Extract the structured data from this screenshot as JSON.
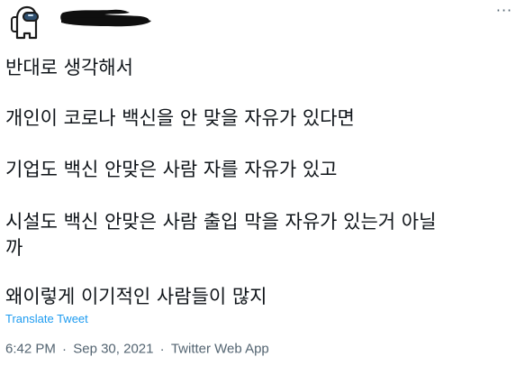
{
  "tweet": {
    "lines": [
      "반대로 생각해서",
      "개인이 코로나 백신을 안 맞을 자유가 있다면",
      "기업도 백신 안맞은 사람 자를 자유가 있고",
      "시설도 백신 안맞은 사람 출입 막을 자유가 있는거 아닐",
      "까",
      "왜이렇게 이기적인 사람들이 많지"
    ],
    "translate_label": "Translate Tweet",
    "more_label": "···",
    "timestamp_time": "6:42 PM",
    "timestamp_date": "Sep 30, 2021",
    "separator": "·",
    "source": "Twitter Web App"
  },
  "colors": {
    "text": "#0f1419",
    "muted": "#536471",
    "link": "#1d9bf0",
    "avatar_body": "#ffffff",
    "avatar_outline": "#1b1b1b",
    "avatar_visor": "#2f4f6f"
  },
  "icons": {
    "avatar": "among-us-crewmate-icon",
    "more": "more-options-icon"
  }
}
